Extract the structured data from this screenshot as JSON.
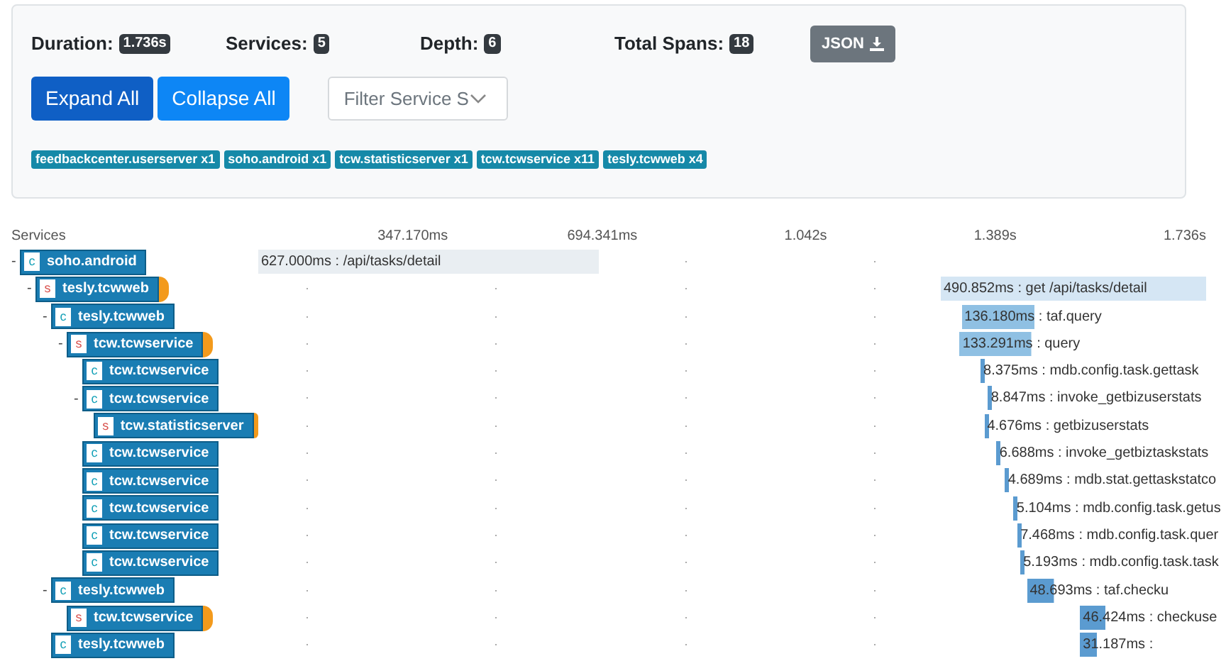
{
  "summary": {
    "stats": [
      {
        "label": "Duration:",
        "value": "1.736s"
      },
      {
        "label": "Services:",
        "value": "5"
      },
      {
        "label": "Depth:",
        "value": "6"
      },
      {
        "label": "Total Spans:",
        "value": "18"
      }
    ],
    "json_button": "JSON"
  },
  "buttons": [
    {
      "label": "Expand All",
      "selected": true
    },
    {
      "label": "Collapse All",
      "selected": false
    }
  ],
  "filter": {
    "placeholder": "Filter Service S"
  },
  "service_tags": [
    "feedbackcenter.userserver x1",
    "soho.android x1",
    "tcw.statisticserver x1",
    "tcw.tcwservice x11",
    "tesly.tcwweb x4"
  ],
  "timeline": {
    "heading": "Services",
    "ticks": [
      "347.170ms",
      "694.341ms",
      "1.042s",
      "1.389s",
      "1.736s"
    ]
  },
  "spans": [
    {
      "toggle": "-",
      "kind": "client",
      "letter": "c",
      "service": "soho.android",
      "marked": false,
      "label": "627.000ms : /api/tasks/detail",
      "children": [
        {
          "toggle": "-",
          "kind": "server",
          "letter": "s",
          "service": "tesly.tcwweb",
          "marked": true,
          "label": "490.852ms : get /api/tasks/detail",
          "children": [
            {
              "toggle": "-",
              "kind": "client",
              "letter": "c",
              "service": "tesly.tcwweb",
              "marked": false,
              "label": "136.180ms : taf.query",
              "children": [
                {
                  "toggle": "-",
                  "kind": "server",
                  "letter": "s",
                  "service": "tcw.tcwservice",
                  "marked": true,
                  "label": "133.291ms : query",
                  "children": [
                    {
                      "kind": "client",
                      "letter": "c",
                      "service": "tcw.tcwservice",
                      "marked": false,
                      "label": "8.375ms : mdb.config.task.gettask"
                    },
                    {
                      "toggle": "-",
                      "kind": "client",
                      "letter": "c",
                      "service": "tcw.tcwservice",
                      "marked": false,
                      "label": "8.847ms : invoke_getbizuserstats",
                      "children": [
                        {
                          "kind": "server",
                          "letter": "s",
                          "service": "tcw.statisticserver",
                          "marked": true,
                          "label": "4.676ms : getbizuserstats"
                        }
                      ]
                    },
                    {
                      "kind": "client",
                      "letter": "c",
                      "service": "tcw.tcwservice",
                      "marked": false,
                      "label": "6.688ms : invoke_getbiztaskstats"
                    },
                    {
                      "kind": "client",
                      "letter": "c",
                      "service": "tcw.tcwservice",
                      "marked": false,
                      "label": "4.689ms : mdb.stat.gettaskstatco"
                    },
                    {
                      "kind": "client",
                      "letter": "c",
                      "service": "tcw.tcwservice",
                      "marked": false,
                      "label": "5.104ms : mdb.config.task.getus"
                    },
                    {
                      "kind": "client",
                      "letter": "c",
                      "service": "tcw.tcwservice",
                      "marked": false,
                      "label": "7.468ms : mdb.config.task.quer"
                    },
                    {
                      "kind": "client",
                      "letter": "c",
                      "service": "tcw.tcwservice",
                      "marked": false,
                      "label": "5.193ms : mdb.config.task.task"
                    }
                  ]
                }
              ]
            },
            {
              "toggle": "-",
              "kind": "client",
              "letter": "c",
              "service": "tesly.tcwweb",
              "marked": false,
              "label": "48.693ms : taf.checku",
              "children": [
                {
                  "kind": "server",
                  "letter": "s",
                  "service": "tcw.tcwservice",
                  "marked": true,
                  "label": "46.424ms : checkuse"
                }
              ]
            },
            {
              "kind": "client",
              "letter": "c",
              "service": "tesly.tcwweb",
              "marked": false,
              "label": "31.187ms :"
            }
          ]
        }
      ]
    }
  ]
}
